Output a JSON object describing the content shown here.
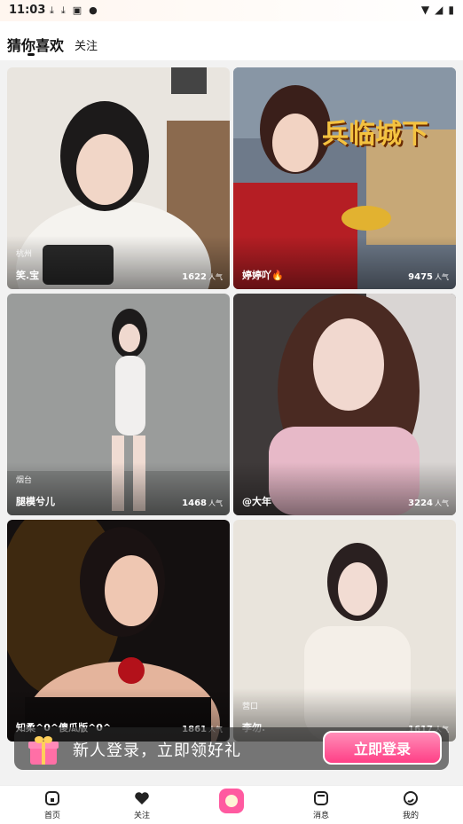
{
  "status_bar": {
    "time": "11:03",
    "battery_icon": "battery-icon",
    "signal_icon": "signal-icon",
    "wifi_icon": "wifi-icon"
  },
  "header": {
    "tabs": [
      {
        "label": "猜你喜欢",
        "active": true
      },
      {
        "label": "关注",
        "active": false
      }
    ]
  },
  "cards": [
    {
      "location": "杭州",
      "name": "笑.宝",
      "popularity": "1622",
      "unit": "人气"
    },
    {
      "location": "",
      "name": "婷婷吖🔥",
      "popularity": "9475",
      "unit": "人气"
    },
    {
      "location": "烟台",
      "name": "腿模兮儿",
      "popularity": "1468",
      "unit": "人气"
    },
    {
      "location": "",
      "name": "@大年",
      "popularity": "3224",
      "unit": "人气"
    },
    {
      "location": "",
      "name": "知柔^0^傻瓜版^0^",
      "popularity": "1861",
      "unit": "人气"
    },
    {
      "location": "营口",
      "name": "李勿.",
      "popularity": "1617",
      "unit": "人气"
    }
  ],
  "promo_game_text": "兵临城下",
  "login_banner": {
    "text": "新人登录，立即领好礼",
    "button": "立即登录"
  },
  "bottom_nav": [
    {
      "label": "首页",
      "icon": "home-icon"
    },
    {
      "label": "关注",
      "icon": "heart-icon"
    },
    {
      "label": "",
      "icon": "live-center-icon"
    },
    {
      "label": "消息",
      "icon": "message-icon"
    },
    {
      "label": "我的",
      "icon": "profile-icon"
    }
  ],
  "colors": {
    "accent": "#ff3f86",
    "banner_bg": "#282828"
  }
}
